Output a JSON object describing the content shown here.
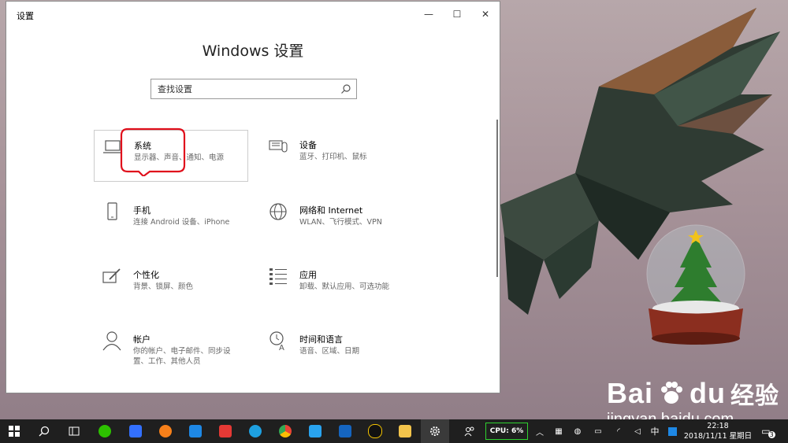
{
  "window": {
    "title": "设置",
    "heading": "Windows 设置",
    "controls": {
      "minimize": "—",
      "maximize": "☐",
      "close": "✕"
    }
  },
  "search": {
    "placeholder": "查找设置"
  },
  "categories": [
    {
      "title": "系统",
      "desc": "显示器、声音、通知、电源",
      "icon": "laptop-icon"
    },
    {
      "title": "设备",
      "desc": "蓝牙、打印机、鼠标",
      "icon": "keyboard-icon"
    },
    {
      "title": "手机",
      "desc": "连接 Android 设备、iPhone",
      "icon": "phone-icon"
    },
    {
      "title": "网络和 Internet",
      "desc": "WLAN、飞行模式、VPN",
      "icon": "globe-icon"
    },
    {
      "title": "个性化",
      "desc": "背景、锁屏、颜色",
      "icon": "paint-icon"
    },
    {
      "title": "应用",
      "desc": "卸载、默认应用、可选功能",
      "icon": "apps-list-icon"
    },
    {
      "title": "帐户",
      "desc": "你的帐户、电子邮件、同步设\n置、工作、其他人员",
      "icon": "person-icon"
    },
    {
      "title": "时间和语言",
      "desc": "语音、区域、日期",
      "icon": "time-language-icon"
    }
  ],
  "watermark": {
    "line1": "Bai",
    "line1b": "du",
    "line1c": "经验",
    "line2": "jingyan.baidu.com"
  },
  "taskbar": {
    "cpu": "CPU:  6%",
    "ime": "中",
    "time": "22:18",
    "date": "2018/11/11 星期日",
    "notifications": "3"
  }
}
